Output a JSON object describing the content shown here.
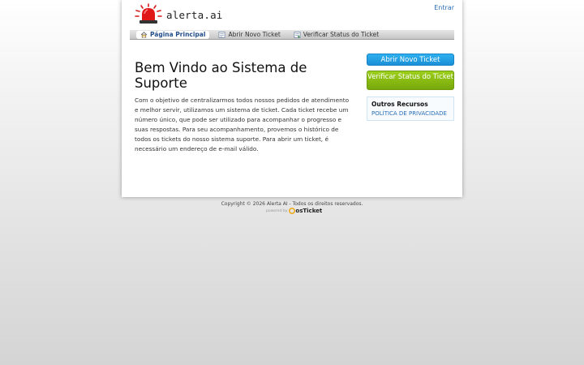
{
  "header": {
    "logo_text": "alerta.ai",
    "login_label": "Entrar"
  },
  "nav": {
    "items": [
      {
        "label": "Página Principal",
        "icon": "home-icon",
        "active": true
      },
      {
        "label": "Abrir Novo Ticket",
        "icon": "new-ticket-icon",
        "active": false
      },
      {
        "label": "Verificar Status do Ticket",
        "icon": "ticket-status-icon",
        "active": false
      }
    ]
  },
  "main": {
    "title": "Bem Vindo ao Sistema de Suporte",
    "intro": "Com o objetivo de centralizarmos todos nossos pedidos de atendimento e melhor servir, utilizamos um sistema de ticket. Cada ticket recebe um número único, que pode ser utilizado para acompanhar o progresso e suas respostas. Para seu acompanhamento, provemos o histórico de todos os tickets do nosso sistema suporte. Para abrir um ticket, é necessário um endereço de e-mail válido."
  },
  "sidebar": {
    "open_ticket_label": "Abrir Novo Ticket",
    "check_status_label": "Verificar Status do Ticket",
    "resources_title": "Outros Recursos",
    "privacy_link": "POLÍTICA DE PRIVACIDADE"
  },
  "footer": {
    "copyright": "Copyright © 2026 Alerta AI - Todos os direitos reservados.",
    "powered_by": "powered by",
    "brand": "osTicket"
  },
  "colors": {
    "accent_blue": "#1b8fd6",
    "accent_green": "#78a80c",
    "link": "#2a6fb5"
  }
}
